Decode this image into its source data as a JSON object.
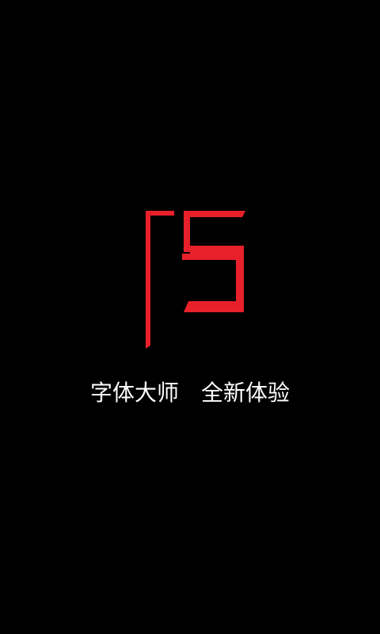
{
  "splash": {
    "app_name": "字体大师",
    "slogan": "全新体验",
    "logo_icon": "fs-logo-icon"
  },
  "colors": {
    "background": "#000000",
    "logo_red": "#e8202a",
    "text": "#ffffff"
  }
}
